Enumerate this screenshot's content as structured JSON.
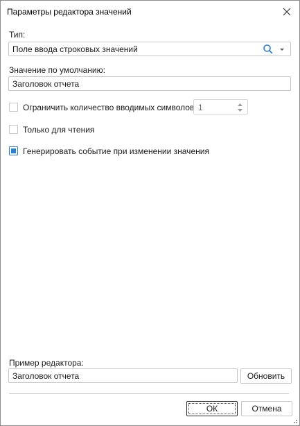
{
  "dialog": {
    "title": "Параметры редактора значений"
  },
  "type_field": {
    "label": "Тип:",
    "value": "Поле ввода строковых значений"
  },
  "default_value": {
    "label": "Значение по умолчанию:",
    "value": "Заголовок отчета"
  },
  "options": {
    "limit_chars": {
      "label": "Ограничить количество вводимых символов",
      "checked": false,
      "count": "1"
    },
    "read_only": {
      "label": "Только для чтения",
      "checked": false
    },
    "raise_event": {
      "label": "Генерировать событие при изменении значения",
      "checked": true
    }
  },
  "preview": {
    "label": "Пример редактора:",
    "value": "Заголовок отчета",
    "refresh_label": "Обновить"
  },
  "footer": {
    "ok_label": "ОК",
    "cancel_label": "Отмена"
  },
  "colors": {
    "accent": "#2c7fd1",
    "border": "#c6c6c6"
  },
  "icons": [
    "close-icon",
    "search-icon",
    "chevron-down-icon",
    "spin-up-icon",
    "spin-down-icon",
    "resize-grip-icon"
  ]
}
